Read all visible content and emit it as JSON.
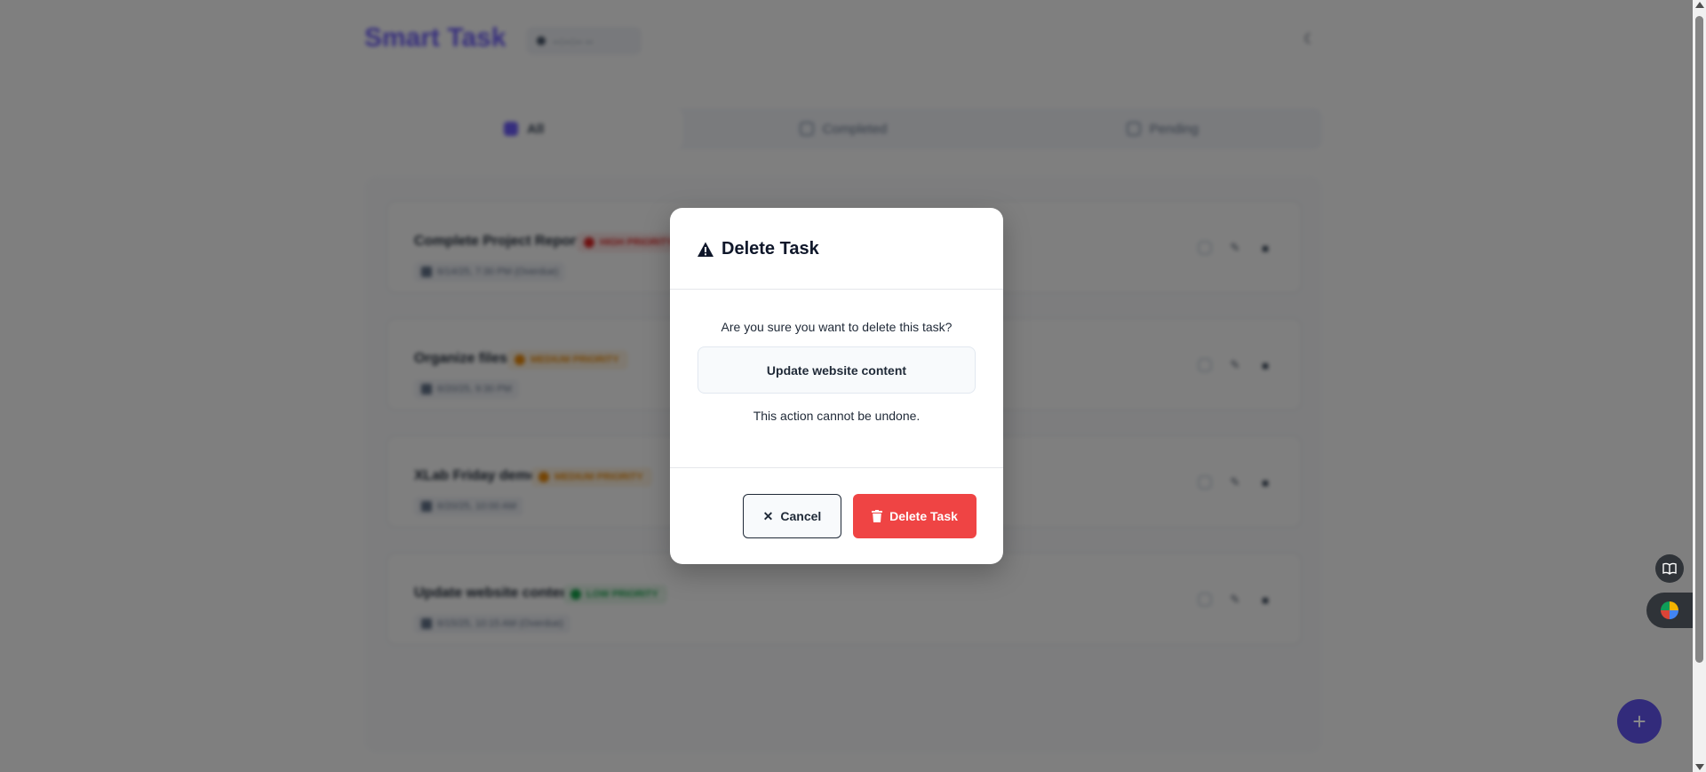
{
  "app": {
    "brand": "Smart Task",
    "clock": "--:--:-- --",
    "theme_icon": "moon-icon"
  },
  "tabs": [
    {
      "label": "All",
      "active": true
    },
    {
      "label": "Completed",
      "active": false
    },
    {
      "label": "Pending",
      "active": false
    }
  ],
  "tasks": [
    {
      "title": "Complete Project Report",
      "priority": "HIGH PRIORITY",
      "level": "high",
      "due": "6/14/25, 7:30 PM (Overdue)"
    },
    {
      "title": "Organize files",
      "priority": "MEDIUM PRIORITY",
      "level": "med",
      "due": "6/20/25, 9:30 PM"
    },
    {
      "title": "XLab Friday demo",
      "priority": "MEDIUM PRIORITY",
      "level": "med",
      "due": "6/20/25, 10:00 AM"
    },
    {
      "title": "Update website content",
      "priority": "LOW PRIORITY",
      "level": "low",
      "due": "6/15/25, 10:15 AM (Overdue)"
    }
  ],
  "modal": {
    "title": "Delete Task",
    "question": "Are you sure you want to delete this task?",
    "task_name": "Update website content",
    "warning": "This action cannot be undone.",
    "cancel_label": "Cancel",
    "delete_label": "Delete Task"
  },
  "colors": {
    "accent": "#6d5dfc",
    "danger": "#ef4444",
    "overlay": "rgba(0,0,0,0.5)"
  }
}
